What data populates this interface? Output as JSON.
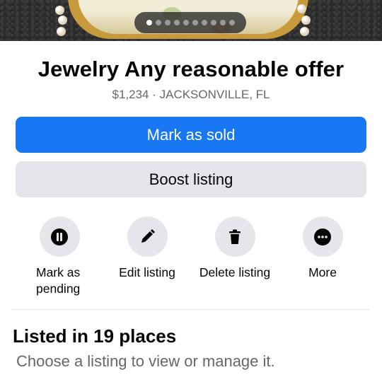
{
  "photo": {
    "page_count": 10,
    "active_index": 0
  },
  "listing": {
    "title": "Jewelry Any reasonable offer",
    "price_location": "$1,234 · JACKSONVILLE, FL"
  },
  "buttons": {
    "mark_sold": "Mark as sold",
    "boost": "Boost listing"
  },
  "actions": [
    {
      "label": "Mark as pending",
      "icon": "pause-icon"
    },
    {
      "label": "Edit listing",
      "icon": "pencil-icon"
    },
    {
      "label": "Delete listing",
      "icon": "trash-icon"
    },
    {
      "label": "More",
      "icon": "more-dots-icon"
    }
  ],
  "places": {
    "title": "Listed in 19 places",
    "subtitle": "Choose a listing to view or manage it."
  },
  "colors": {
    "primary": "#1877f2",
    "secondary_bg": "#e4e6eb",
    "muted_text": "#65676b"
  }
}
